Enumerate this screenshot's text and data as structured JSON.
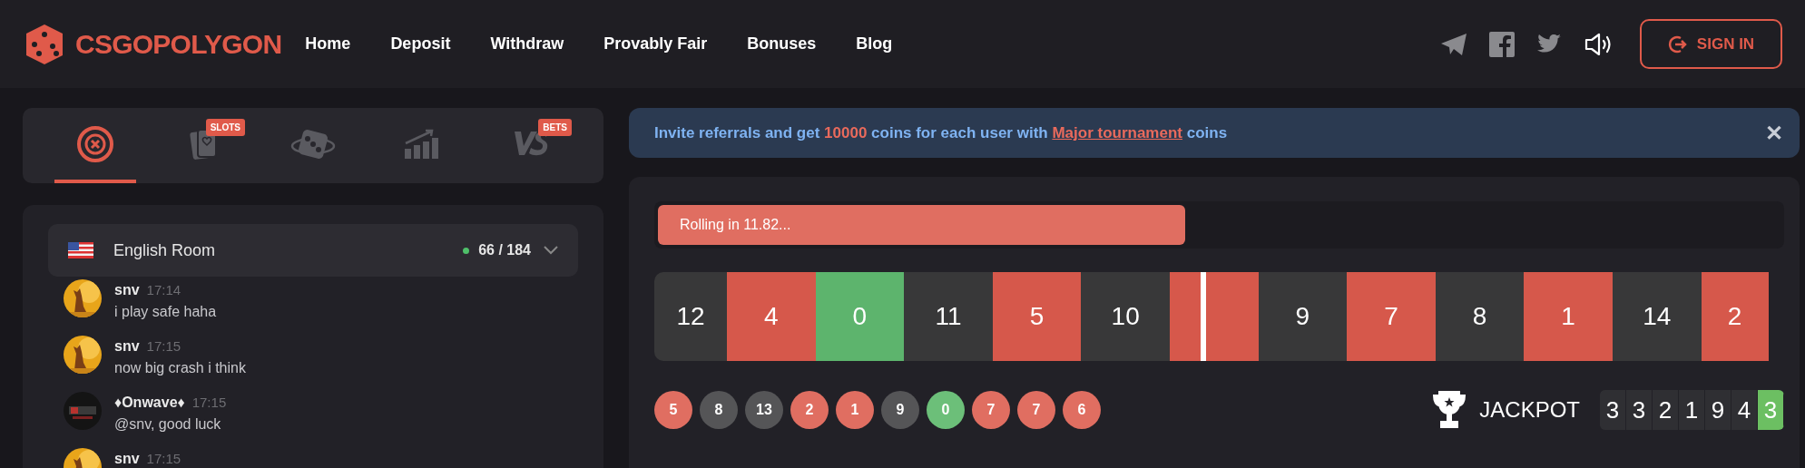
{
  "header": {
    "logo": "CSGOPOLYGON",
    "nav": [
      "Home",
      "Deposit",
      "Withdraw",
      "Provably Fair",
      "Bonuses",
      "Blog"
    ],
    "sign_in": "SIGN IN"
  },
  "game_tabs": [
    {
      "kind": "roulette",
      "selected": true
    },
    {
      "kind": "slots",
      "badge": "SLOTS",
      "selected": false
    },
    {
      "kind": "dice",
      "selected": false
    },
    {
      "kind": "crash",
      "selected": false
    },
    {
      "kind": "versus",
      "badge": "BETS",
      "selected": false
    }
  ],
  "chat": {
    "room": "English Room",
    "online": "66 / 184",
    "messages": [
      {
        "user": "snv",
        "time": "17:14",
        "text": "i play safe haha",
        "kind": "dog"
      },
      {
        "user": "snv",
        "time": "17:15",
        "text": "now big crash i think",
        "kind": "dog"
      },
      {
        "user": "♦Onwave♦",
        "time": "17:15",
        "text": "@snv, good luck",
        "kind": "logo"
      },
      {
        "user": "snv",
        "time": "17:15",
        "kind": "dog"
      }
    ]
  },
  "banner": {
    "parts": [
      {
        "kind": "plain",
        "text": "Invite referrals and get "
      },
      {
        "kind": "number",
        "text": "10000"
      },
      {
        "kind": "plain",
        "text": " coins for each user with "
      },
      {
        "kind": "link",
        "text": "Major tournament"
      },
      {
        "kind": "plain",
        "text": " coins"
      }
    ],
    "close": "✕"
  },
  "roulette": {
    "status": "Rolling in 11.82...",
    "level": 0.47,
    "tiles": [
      {
        "number": "12",
        "color": "#383839"
      },
      {
        "number": "4",
        "color": "#d6584b"
      },
      {
        "number": "0",
        "color": "#5db46d"
      },
      {
        "number": "11",
        "color": "#383839"
      },
      {
        "number": "5",
        "color": "#d6584b"
      },
      {
        "number": "10",
        "color": "#383839"
      },
      {
        "color": "#d6584b",
        "marker": true
      },
      {
        "number": "9",
        "color": "#383839"
      },
      {
        "number": "7",
        "color": "#d6584b"
      },
      {
        "number": "8",
        "color": "#383839"
      },
      {
        "number": "1",
        "color": "#d6584b"
      },
      {
        "number": "14",
        "color": "#383839"
      },
      {
        "number": "2",
        "color": "#d6584b"
      }
    ],
    "history": [
      {
        "number": "5",
        "color": "#e06e61"
      },
      {
        "number": "8",
        "color": "#555557"
      },
      {
        "number": "13",
        "color": "#555557"
      },
      {
        "number": "2",
        "color": "#e06e61"
      },
      {
        "number": "1",
        "color": "#e06e61"
      },
      {
        "number": "9",
        "color": "#555557"
      },
      {
        "number": "0",
        "color": "#6cbf79"
      },
      {
        "number": "7",
        "color": "#e06e61"
      },
      {
        "number": "7",
        "color": "#e06e61"
      },
      {
        "number": "6",
        "color": "#e06e61"
      }
    ],
    "jackpot": {
      "label": "JACKPOT",
      "digits": [
        {
          "digit": "3",
          "color": "#2f2f33"
        },
        {
          "digit": "3",
          "color": "#2f2f33"
        },
        {
          "digit": "2",
          "color": "#2f2f33"
        },
        {
          "digit": "1",
          "color": "#2f2f33"
        },
        {
          "digit": "9",
          "color": "#2f2f33"
        },
        {
          "digit": "4",
          "color": "#2f2f33"
        },
        {
          "digit": "3",
          "color": "#6cbf62"
        }
      ]
    }
  }
}
